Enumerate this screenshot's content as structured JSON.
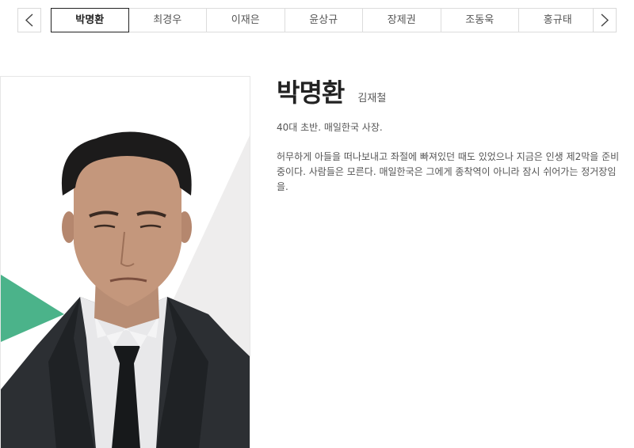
{
  "nav": {
    "prev_icon": "chevron-left-icon",
    "next_icon": "chevron-right-icon"
  },
  "tabs": [
    {
      "label": "박명환",
      "active": true
    },
    {
      "label": "최경우",
      "active": false
    },
    {
      "label": "이재은",
      "active": false
    },
    {
      "label": "윤상규",
      "active": false
    },
    {
      "label": "장제권",
      "active": false
    },
    {
      "label": "조동욱",
      "active": false
    },
    {
      "label": "홍규태",
      "active": false
    }
  ],
  "profile": {
    "name": "박명환",
    "actor": "김재철",
    "role": "40대 초반. 매일한국 사장.",
    "description": "허무하게 아들을 떠나보내고 좌절에 빠져있던 때도 있었으나 지금은 인생 제2막을 준비 중이다. 사람들은 모른다. 매일한국은 그에게 종착역이 아니라 잠시 쉬어가는 정거장임을."
  },
  "colors": {
    "accent_green": "#4bb38a",
    "panel_gray": "#efeeee",
    "active_tab_border": "#222222"
  }
}
